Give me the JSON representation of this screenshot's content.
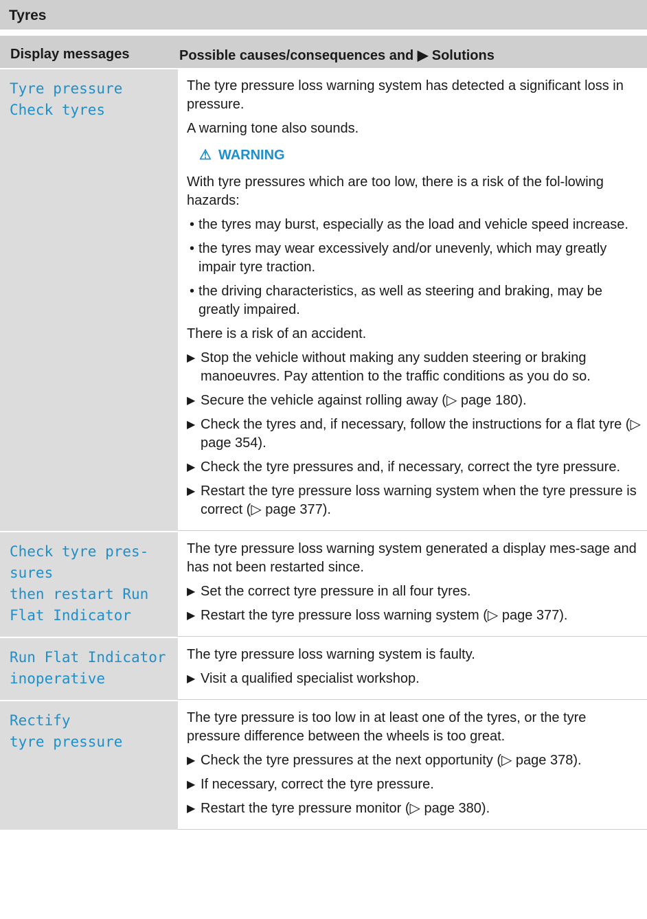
{
  "section_title": "Tyres",
  "table": {
    "headers": [
      "Display messages",
      "Possible causes/consequences and ▶ Solutions"
    ],
    "rows": [
      {
        "message": "Tyre pressure\nCheck tyres",
        "p1": "The tyre pressure loss warning system has detected a significant loss in pressure.",
        "p2": "A warning tone also sounds.",
        "warning_title": "WARNING",
        "warning_intro": "With tyre pressures which are too low, there is a risk of the fol-lowing hazards:",
        "bullets": [
          "the tyres may burst, especially as the load and vehicle speed increase.",
          "the tyres may wear excessively and/or unevenly, which may greatly impair tyre traction.",
          "the driving characteristics, as well as steering and braking, may be greatly impaired."
        ],
        "risk": "There is a risk of an accident.",
        "steps": [
          "Stop the vehicle without making any sudden steering or braking manoeuvres. Pay attention to the traffic conditions as you do so.",
          "Secure the vehicle against rolling away (▷ page 180).",
          "Check the tyres and, if necessary, follow the instructions for a flat tyre (▷ page 354).",
          "Check the tyre pressures and, if necessary, correct the tyre pressure.",
          "Restart the tyre pressure loss warning system when the tyre pressure is correct (▷ page 377)."
        ]
      },
      {
        "message": "Check tyre pres-\nsures\nthen restart Run\nFlat Indicator",
        "p1": "The tyre pressure loss warning system generated a display mes-sage and has not been restarted since.",
        "steps": [
          "Set the correct tyre pressure in all four tyres.",
          "Restart the tyre pressure loss warning system (▷ page 377)."
        ]
      },
      {
        "message": "Run Flat Indicator\ninoperative",
        "p1": "The tyre pressure loss warning system is faulty.",
        "steps": [
          "Visit a qualified specialist workshop."
        ]
      },
      {
        "message": "Rectify\ntyre pressure",
        "p1": "The tyre pressure is too low in at least one of the tyres, or the tyre pressure difference between the wheels is too great.",
        "steps": [
          "Check the tyre pressures at the next opportunity (▷ page 378).",
          "If necessary, correct the tyre pressure.",
          "Restart the tyre pressure monitor (▷ page 380)."
        ]
      }
    ]
  },
  "colors": {
    "message_text": "#1f8fc9",
    "header_bg": "#cfcfcf",
    "left_col_bg": "#dcdcdc"
  },
  "icons": {
    "warning": "warning-triangle-icon",
    "step": "arrow-right-icon",
    "bullet": "bullet-icon"
  }
}
